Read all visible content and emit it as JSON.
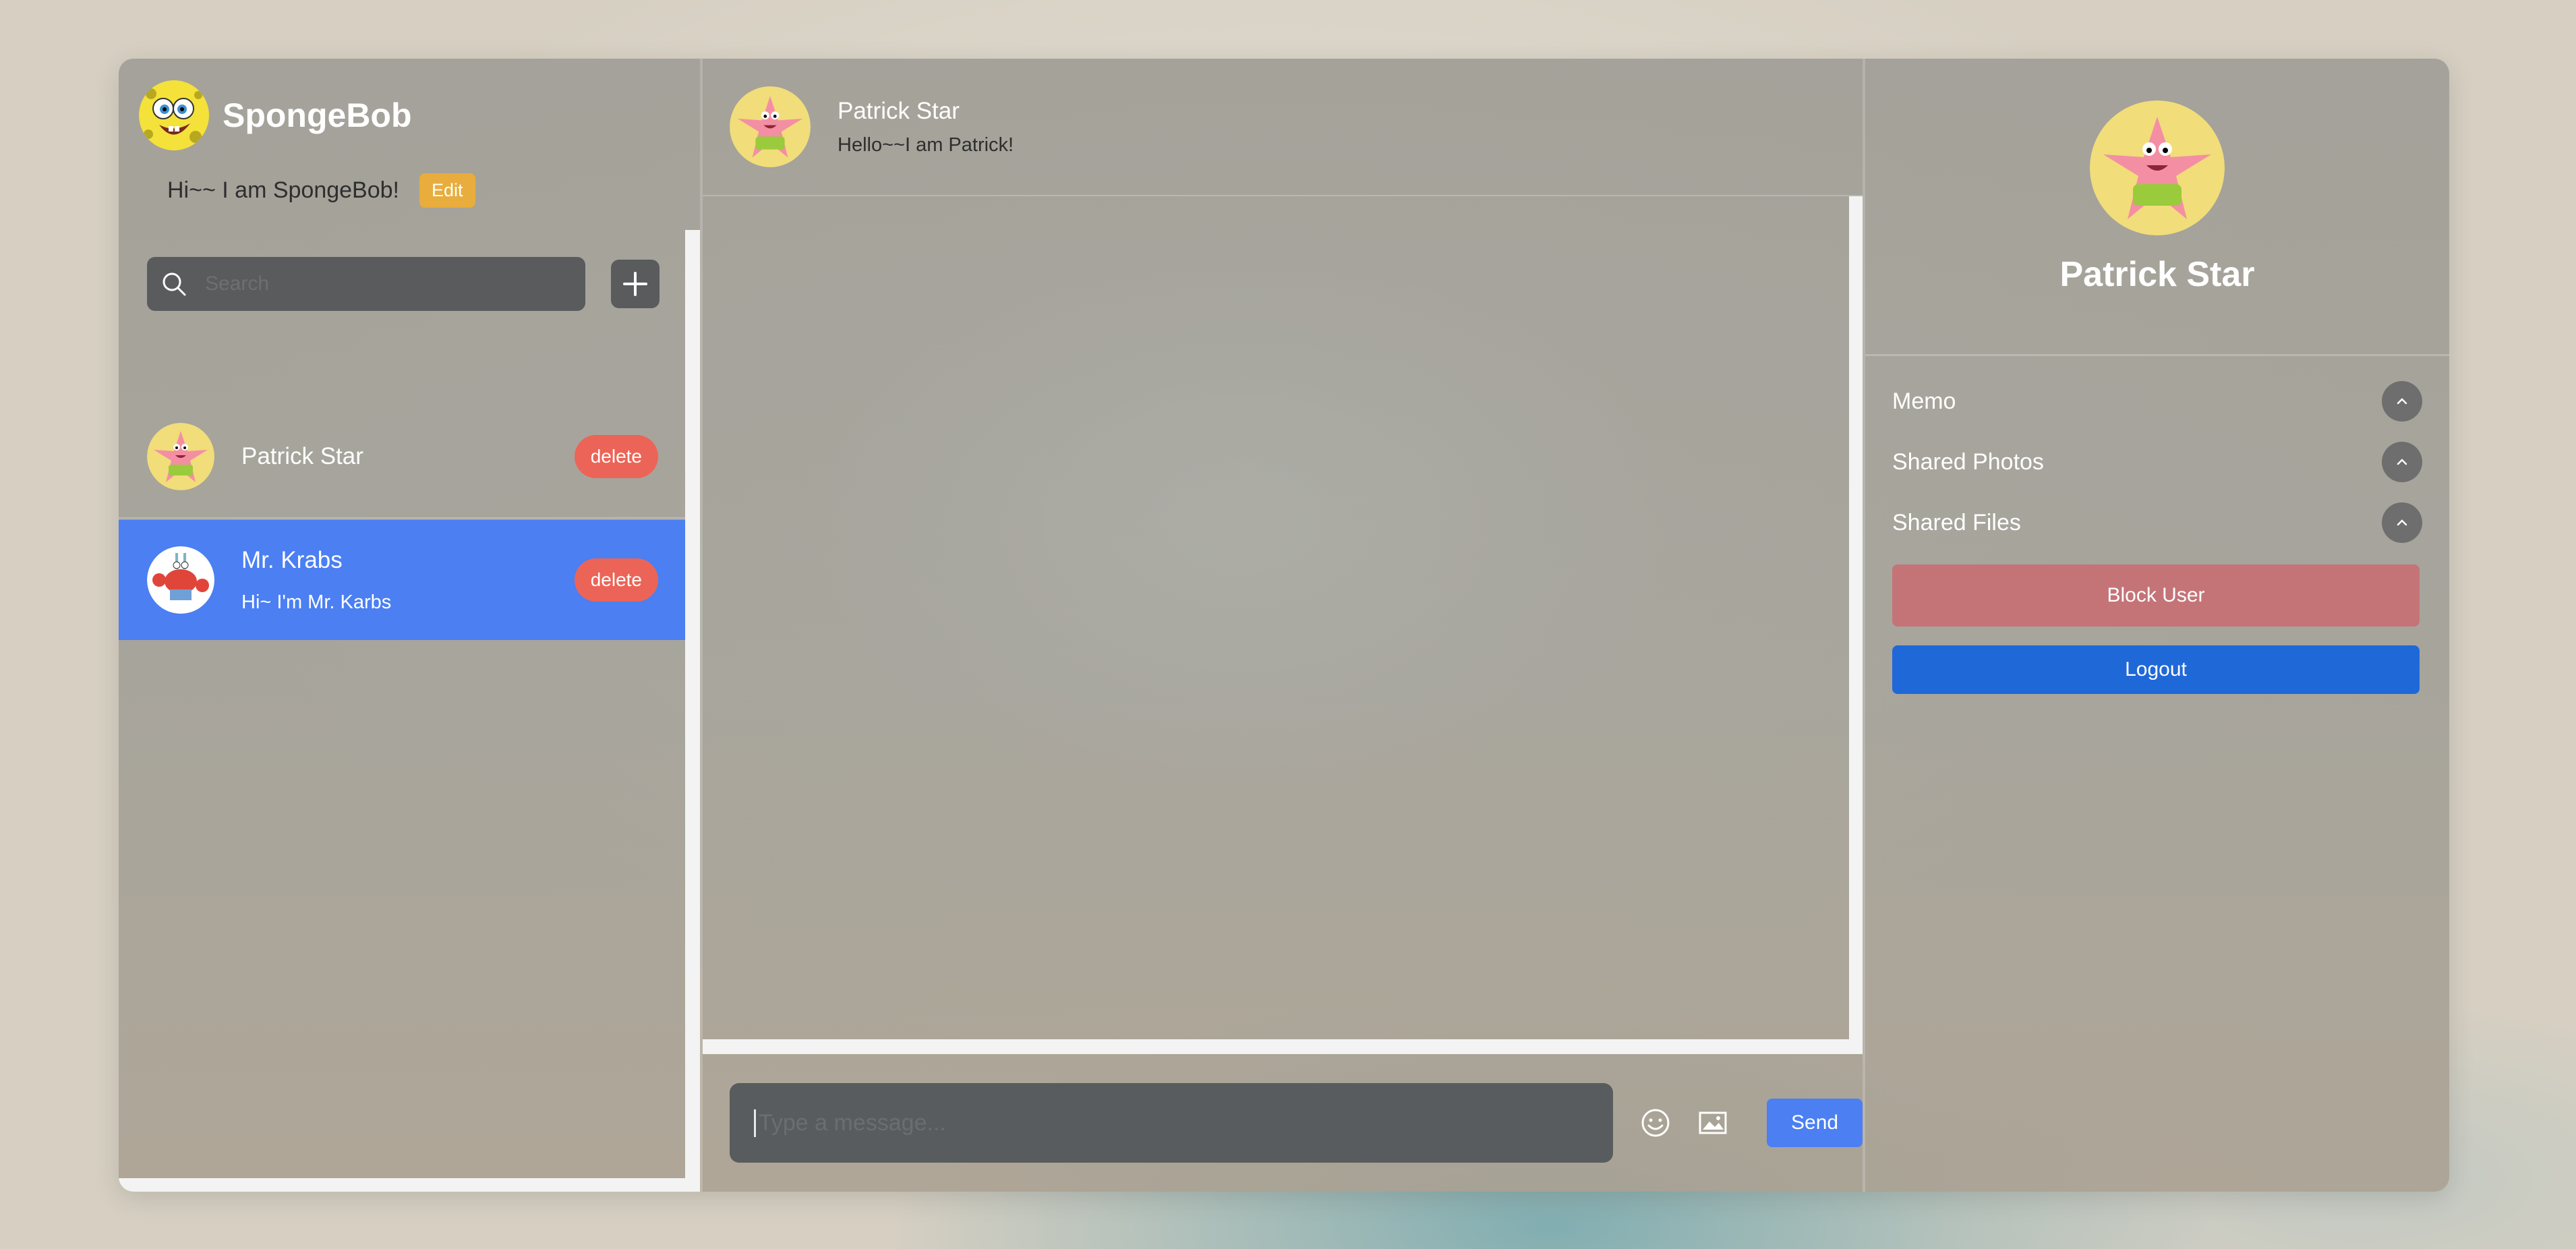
{
  "me": {
    "name": "SpongeBob",
    "status": "Hi~~ I am SpongeBob!",
    "edit_label": "Edit"
  },
  "search": {
    "placeholder": "Search"
  },
  "contacts": [
    {
      "name": "Patrick Star",
      "last_message": "",
      "delete_label": "delete",
      "selected": false,
      "avatar": "patrick-star"
    },
    {
      "name": "Mr. Krabs",
      "last_message": "Hi~ I'm Mr. Karbs",
      "delete_label": "delete",
      "selected": true,
      "avatar": "mr-krabs"
    }
  ],
  "chat": {
    "name": "Patrick Star",
    "status": "Hello~~I am Patrick!",
    "input_placeholder": "Type a message...",
    "send_label": "Send",
    "icons": [
      "emoji-icon",
      "image-icon"
    ]
  },
  "details": {
    "name": "Patrick Star",
    "sections": [
      "Memo",
      "Shared Photos",
      "Shared Files"
    ],
    "block_label": "Block User",
    "logout_label": "Logout"
  },
  "colors": {
    "accent": "#4b7ff2",
    "delete": "#ec6457",
    "edit": "#e8ad3c",
    "block": "#c47477",
    "logout": "#1f68d8"
  }
}
